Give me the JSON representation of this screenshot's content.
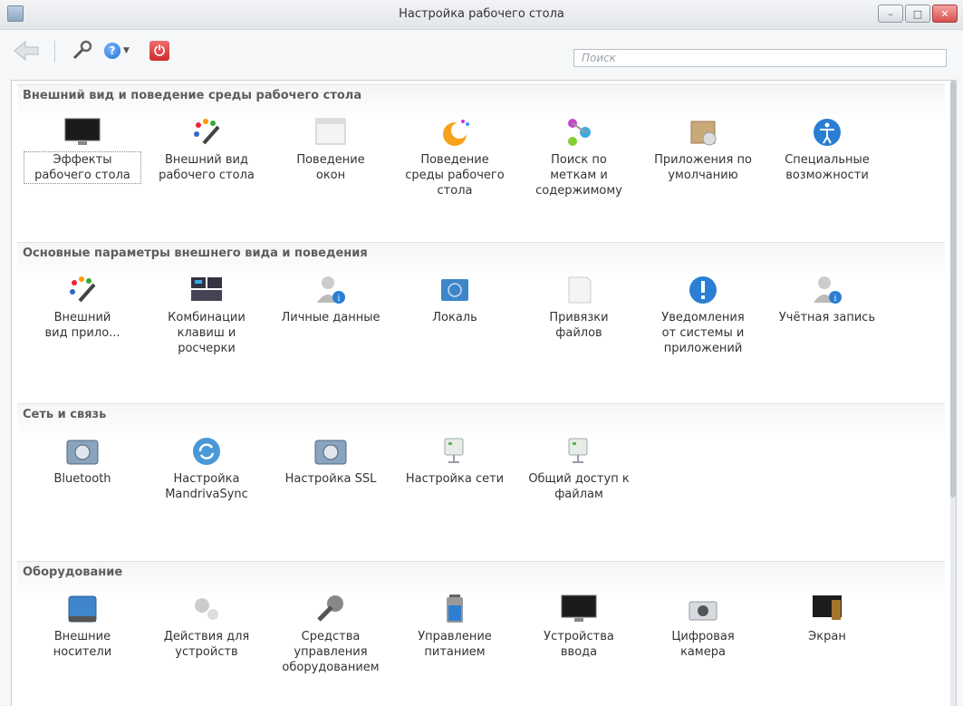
{
  "window": {
    "title": "Настройка рабочего стола"
  },
  "toolbar": {
    "search_placeholder": "Поиск"
  },
  "sections": [
    {
      "title": "Внешний вид и поведение среды рабочего стола",
      "items": [
        {
          "label": "Эффекты\nрабочего стола",
          "icon": "monitor-icon"
        },
        {
          "label": "Внешний вид\nрабочего стола",
          "icon": "palette-brush-icon"
        },
        {
          "label": "Поведение\nокон",
          "icon": "window-icon"
        },
        {
          "label": "Поведение\nсреды рабочего\nстола",
          "icon": "desktop-behavior-icon"
        },
        {
          "label": "Поиск по\nметкам и\nсодержимому",
          "icon": "nepomuk-icon"
        },
        {
          "label": "Приложения по\nумолчанию",
          "icon": "default-apps-icon"
        },
        {
          "label": "Специальные\nвозможности",
          "icon": "accessibility-icon"
        }
      ]
    },
    {
      "title": "Основные параметры внешнего вида и поведения",
      "items": [
        {
          "label": "Внешний\nвид прило...",
          "icon": "palette-brush-icon"
        },
        {
          "label": "Комбинации\nклавиш и\nросчерки",
          "icon": "keyboard-icon"
        },
        {
          "label": "Личные данные",
          "icon": "user-info-icon"
        },
        {
          "label": "Локаль",
          "icon": "locale-icon"
        },
        {
          "label": "Привязки\nфайлов",
          "icon": "file-association-icon"
        },
        {
          "label": "Уведомления\nот системы и\nприложений",
          "icon": "notification-icon"
        },
        {
          "label": "Учётная запись",
          "icon": "user-info-icon"
        }
      ]
    },
    {
      "title": "Сеть и связь",
      "items": [
        {
          "label": "Bluetooth",
          "icon": "network-gear-icon"
        },
        {
          "label": "Настройка\nMandrivaSync",
          "icon": "sync-icon"
        },
        {
          "label": "Настройка SSL",
          "icon": "network-gear-icon"
        },
        {
          "label": "Настройка сети",
          "icon": "network-device-icon"
        },
        {
          "label": "Общий доступ к\nфайлам",
          "icon": "network-device-icon"
        }
      ]
    },
    {
      "title": "Оборудование",
      "items": [
        {
          "label": "Внешние\nносители",
          "icon": "usb-drive-icon"
        },
        {
          "label": "Действия для\nустройств",
          "icon": "gears-icon"
        },
        {
          "label": "Средства\nуправления\nоборудованием",
          "icon": "hardware-tools-icon"
        },
        {
          "label": "Управление\nпитанием",
          "icon": "battery-icon"
        },
        {
          "label": "Устройства\nввода",
          "icon": "monitor-icon"
        },
        {
          "label": "Цифровая\nкамера",
          "icon": "camera-icon"
        },
        {
          "label": "Экран",
          "icon": "display-icon"
        }
      ]
    }
  ]
}
